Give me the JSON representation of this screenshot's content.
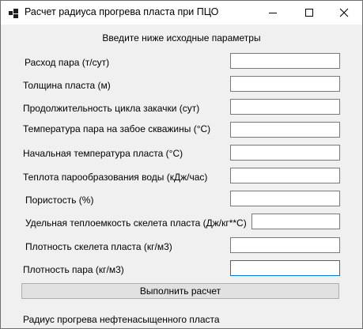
{
  "window": {
    "title": "Расчет радиуса прогрева пласта при ПЦО"
  },
  "form": {
    "header": "Введите ниже исходные параметры",
    "fields": [
      {
        "label": "Расход пара (т/сут)",
        "value": ""
      },
      {
        "label": "Толщина пласта (м)",
        "value": ""
      },
      {
        "label": "Продолжительность цикла закачки (сут)",
        "value": ""
      },
      {
        "label": "Температура пара на забое скважины (°С)",
        "value": ""
      },
      {
        "label": "Начальная температура пласта (°С)",
        "value": ""
      },
      {
        "label": "Теплота парообразования воды (кДж/час)",
        "value": ""
      },
      {
        "label": "Пористость (%)",
        "value": ""
      },
      {
        "label": "Удельная теплоемкость скелета пласта (Дж/кг**С)",
        "value": ""
      },
      {
        "label": "Плотность скелета пласта (кг/м3)",
        "value": ""
      },
      {
        "label": "Плотность пара (кг/м3)",
        "value": ""
      }
    ],
    "run_button": "Выполнить расчет",
    "result_label": "Радиус прогрева нефтенасыщенного пласта"
  }
}
